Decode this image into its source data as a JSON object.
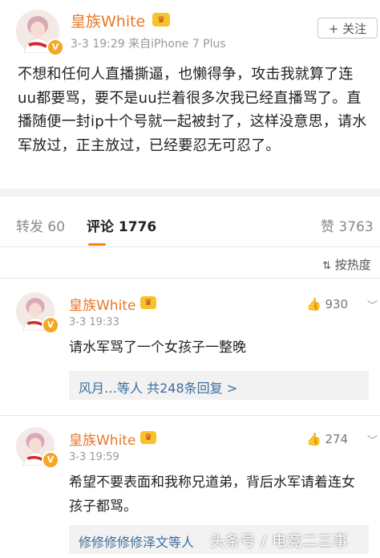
{
  "post": {
    "author": "皇族White",
    "meta": "3-3 19:29  来自iPhone 7 Plus",
    "follow_label": "+ 关注",
    "text": "不想和任何人直播撕逼，也懒得争，攻击我就算了连uu都要骂，要不是uu拦着很多次我已经直播骂了。直播随便一封ip十个号就一起被封了，这样没意思，请水军放过，正主放过，已经要忍无可忍了。"
  },
  "tabs": {
    "repost": "转发 60",
    "comment": "评论 1776",
    "likes": "赞 3763"
  },
  "sort_label": "按热度",
  "colors": {
    "accent": "#ff8200",
    "username": "#e8762a",
    "link": "#3d6d9e"
  },
  "comments": [
    {
      "author": "皇族White",
      "time": "3-3 19:33",
      "likes": "930",
      "text": "请水军骂了一个女孩子一整晚",
      "reply_summary": "风月…等人  共248条回复  >"
    },
    {
      "author": "皇族White",
      "time": "3-3 19:59",
      "likes": "274",
      "text": "希望不要表面和我称兄道弟，背后水军请着连女孩子都骂。",
      "reply_summary": "修修修修修泽文等人"
    }
  ],
  "watermark": "头条号 / 电竞二三事",
  "icons": [
    "avatar",
    "verified-badge-icon",
    "crown-icon",
    "thumb-up-icon",
    "chevron-down-icon",
    "sort-icon"
  ]
}
